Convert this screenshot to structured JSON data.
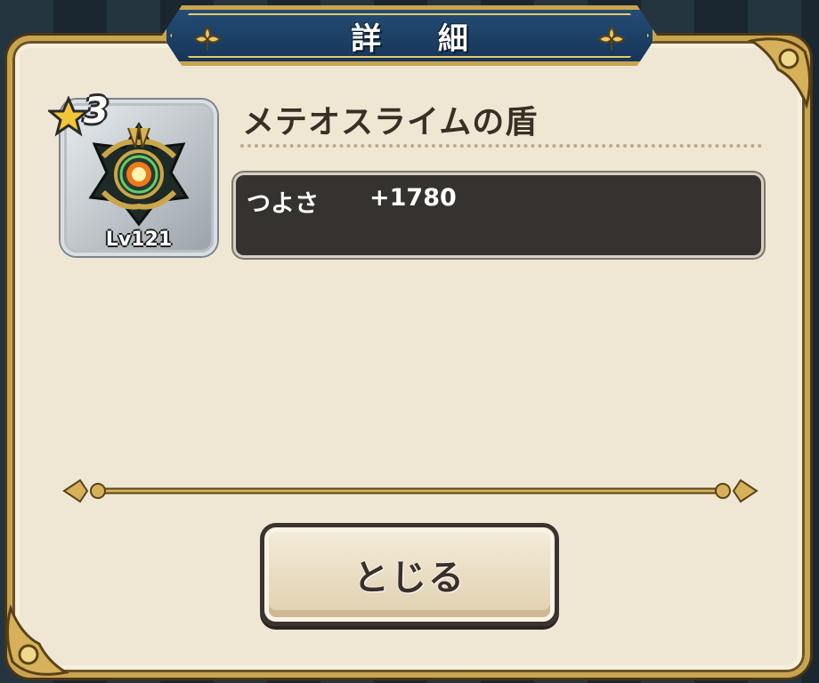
{
  "dialog": {
    "title": "詳細",
    "title_display": "詳 細"
  },
  "item": {
    "rarity_stars": 3,
    "rarity_label": "3",
    "level_label": "Lv121",
    "name": "メテオスライムの盾",
    "icon": "meteor-slime-shield-icon"
  },
  "stats": [
    {
      "label": "つよさ",
      "value": "+1780"
    }
  ],
  "buttons": {
    "close_label": "とじる"
  },
  "colors": {
    "panel_bg": "#efe7d4",
    "gold_trim": "#c9a450",
    "banner_blue": "#1f4468",
    "stat_box_bg": "#353230"
  }
}
